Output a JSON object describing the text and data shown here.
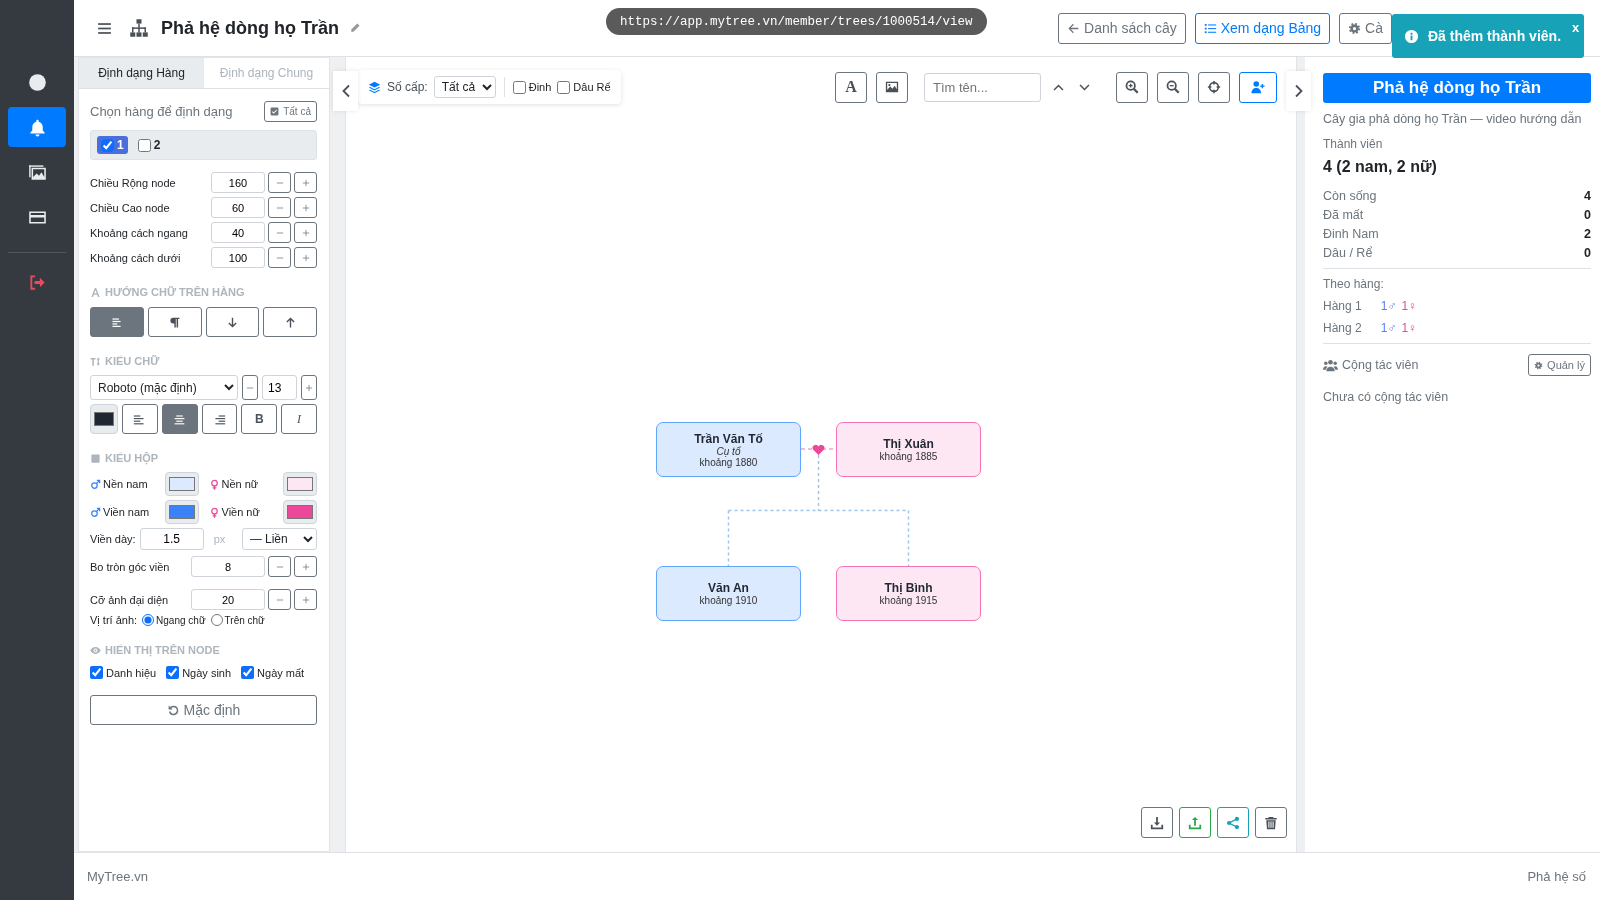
{
  "sidebar": {
    "items": [
      {
        "kind": "avatar",
        "selected": false
      },
      {
        "kind": "bell",
        "selected": true
      },
      {
        "kind": "gallery",
        "selected": false
      },
      {
        "kind": "card",
        "selected": false
      },
      {
        "kind": "logout",
        "selected": false
      }
    ]
  },
  "header": {
    "title": "Phả hệ dòng họ Trần",
    "url": "https://app.mytree.vn/member/trees/1000514/view",
    "buttons": [
      {
        "kind": "back",
        "label": "Danh sách cây",
        "primary": false
      },
      {
        "kind": "list",
        "label": "Xem dạng Bảng",
        "primary": true
      },
      {
        "kind": "settings",
        "label": "Cà",
        "primary": false
      }
    ]
  },
  "toast": {
    "text": "Đã thêm thành viên.",
    "close": "x"
  },
  "format_panel": {
    "tabs": [
      {
        "label": "Định dạng Hàng",
        "selected": true
      },
      {
        "label": "Định dạng Chung",
        "selected": false
      }
    ],
    "row_picker": {
      "label": "Chọn hàng để định dạng",
      "all_button": "Tất cả",
      "rows": [
        {
          "label": "1",
          "checked": true
        },
        {
          "label": "2",
          "checked": false
        }
      ]
    },
    "sizes": [
      {
        "label": "Chiều Rộng node",
        "value": "160"
      },
      {
        "label": "Chiều Cao node",
        "value": "60"
      },
      {
        "label": "Khoảng cách ngang",
        "value": "40"
      },
      {
        "label": "Khoảng cách dưới",
        "value": "100"
      }
    ],
    "text_direction": {
      "heading": "HƯỚNG CHỮ TRÊN HÀNG",
      "options": [
        {
          "kind": "horizontal",
          "selected": true
        },
        {
          "kind": "paragraph",
          "selected": false
        },
        {
          "kind": "down",
          "selected": false
        },
        {
          "kind": "up",
          "selected": false
        }
      ]
    },
    "font": {
      "heading": "KIỂU CHỮ",
      "family": "Roboto (mặc định)",
      "size": "13",
      "color": "#1f2733",
      "align": [
        {
          "kind": "left",
          "selected": false
        },
        {
          "kind": "center",
          "selected": true
        },
        {
          "kind": "right",
          "selected": false
        }
      ],
      "bold": "B",
      "italic": "I"
    },
    "box_style": {
      "heading": "KIỂU HỘP",
      "swatches": [
        {
          "kind": "male",
          "label": "Nền nam",
          "color": "#dbeafe"
        },
        {
          "kind": "female",
          "label": "Nền nữ",
          "color": "#fce7f3"
        },
        {
          "kind": "male",
          "label": "Viền nam",
          "color": "#3b82f6"
        },
        {
          "kind": "female",
          "label": "Viền nữ",
          "color": "#ec4899"
        }
      ],
      "border_width": {
        "label": "Viền dày:",
        "value": "1.5",
        "unit": "px",
        "style": "— Liền"
      },
      "radius": {
        "label": "Bo tròn góc viền",
        "value": "8"
      },
      "avatar_size": {
        "label": "Cỡ ảnh đại diện",
        "value": "20"
      },
      "avatar_position": {
        "label": "Vị trí ảnh:",
        "options": [
          {
            "label": "Ngang chữ",
            "selected": true
          },
          {
            "label": "Trên chữ",
            "selected": false
          }
        ]
      }
    },
    "display": {
      "heading": "HIỂN THỊ TRÊN NODE",
      "options": [
        {
          "label": "Danh hiệu",
          "checked": true
        },
        {
          "label": "Ngày sinh",
          "checked": true
        },
        {
          "label": "Ngày mất",
          "checked": true
        }
      ]
    },
    "reset_button": "Mặc định"
  },
  "toolbar": {
    "levels_label": "Số cấp:",
    "levels_value": "Tất cả",
    "filters": [
      {
        "label": "Đinh",
        "checked": false
      },
      {
        "label": "Dâu Rể",
        "checked": false
      }
    ],
    "font_button": "A",
    "search_placeholder": "Tìm tên..."
  },
  "tree": {
    "generations": [
      {
        "members": [
          {
            "name": "Trần Văn Tố",
            "title": "Cụ tổ",
            "note": "khoảng 1880",
            "kind": "male"
          },
          {
            "name": "Thị Xuân",
            "note": "khoảng 1885",
            "kind": "female"
          }
        ]
      },
      {
        "members": [
          {
            "name": "Văn An",
            "note": "khoảng 1910",
            "kind": "male"
          },
          {
            "name": "Thị Bình",
            "note": "khoảng 1915",
            "kind": "female"
          }
        ]
      }
    ]
  },
  "info_panel": {
    "title": "Phả hệ dòng họ Trần",
    "subtitle": "Cây gia phả dòng họ Trần — video hướng dẫn",
    "members_label": "Thành viên",
    "members_value": "4 (2 nam, 2 nữ)",
    "stats": [
      {
        "label": "Còn sống",
        "value": "4"
      },
      {
        "label": "Đã mất",
        "value": "0"
      },
      {
        "label": "Đinh Nam",
        "value": "2"
      },
      {
        "label": "Dâu / Rể",
        "value": "0"
      }
    ],
    "by_row_label": "Theo hàng:",
    "rows": [
      {
        "label": "Hàng 1",
        "male": "1♂",
        "female": "1♀"
      },
      {
        "label": "Hàng 2",
        "male": "1♂",
        "female": "1♀"
      }
    ],
    "collaborators_label": "Cộng tác viên",
    "manage_button": "Quản lý",
    "empty_text": "Chưa có cộng tác viên"
  },
  "footer": {
    "left": "MyTree.vn",
    "right": "Phả hệ số"
  }
}
